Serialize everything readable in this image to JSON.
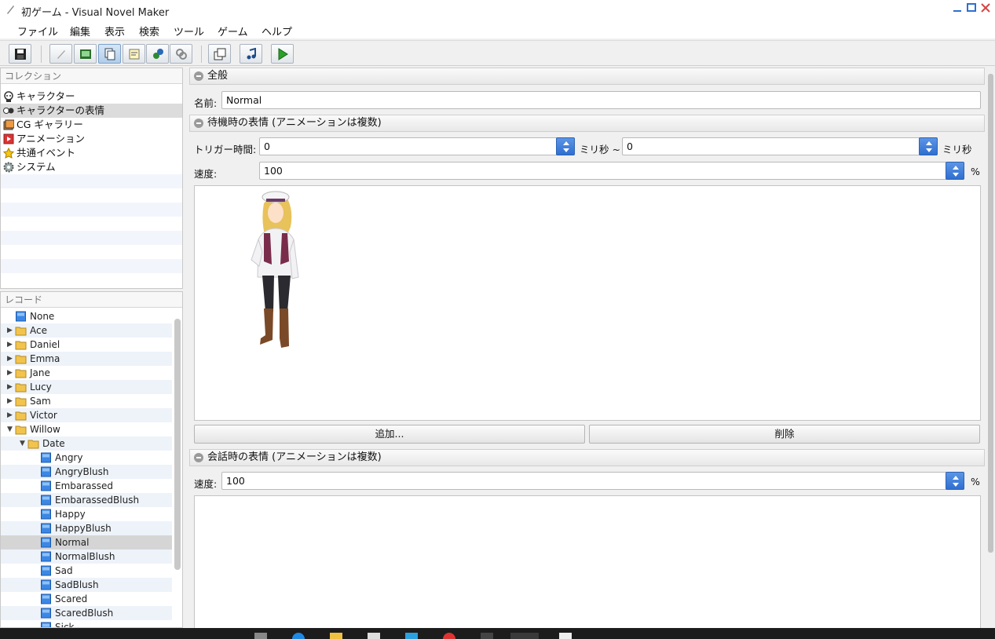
{
  "window": {
    "title": "初ゲーム - Visual Novel Maker"
  },
  "menu": [
    "ファイル",
    "編集",
    "表示",
    "検索",
    "ツール",
    "ゲーム",
    "ヘルプ"
  ],
  "toolbar": {
    "buttons": [
      "save-icon",
      "pencil-icon",
      "picture-icon",
      "database-icon",
      "script-icon",
      "plugin-icon",
      "chain-icon",
      "layers-icon",
      "music-icon",
      "play-icon"
    ],
    "active": "database-icon"
  },
  "collection": {
    "header": "コレクション",
    "items": [
      {
        "label": "キャラクター",
        "icon": "character-icon"
      },
      {
        "label": "キャラクターの表情",
        "icon": "expression-icon",
        "selected": true
      },
      {
        "label": "CG ギャラリー",
        "icon": "gallery-icon"
      },
      {
        "label": "アニメーション",
        "icon": "animation-icon"
      },
      {
        "label": "共通イベント",
        "icon": "star-icon"
      },
      {
        "label": "システム",
        "icon": "gear-icon"
      }
    ]
  },
  "records": {
    "header": "レコード",
    "items": [
      {
        "label": "None",
        "type": "record",
        "depth": 0
      },
      {
        "label": "Ace",
        "type": "folder",
        "depth": 0,
        "state": "collapsed"
      },
      {
        "label": "Daniel",
        "type": "folder",
        "depth": 0,
        "state": "collapsed"
      },
      {
        "label": "Emma",
        "type": "folder",
        "depth": 0,
        "state": "collapsed"
      },
      {
        "label": "Jane",
        "type": "folder",
        "depth": 0,
        "state": "collapsed"
      },
      {
        "label": "Lucy",
        "type": "folder",
        "depth": 0,
        "state": "collapsed"
      },
      {
        "label": "Sam",
        "type": "folder",
        "depth": 0,
        "state": "collapsed"
      },
      {
        "label": "Victor",
        "type": "folder",
        "depth": 0,
        "state": "collapsed"
      },
      {
        "label": "Willow",
        "type": "folder",
        "depth": 0,
        "state": "expanded"
      },
      {
        "label": "Date",
        "type": "folder",
        "depth": 1,
        "state": "expanded"
      },
      {
        "label": "Angry",
        "type": "record",
        "depth": 2
      },
      {
        "label": "AngryBlush",
        "type": "record",
        "depth": 2
      },
      {
        "label": "Embarassed",
        "type": "record",
        "depth": 2
      },
      {
        "label": "EmbarassedBlush",
        "type": "record",
        "depth": 2
      },
      {
        "label": "Happy",
        "type": "record",
        "depth": 2
      },
      {
        "label": "HappyBlush",
        "type": "record",
        "depth": 2
      },
      {
        "label": "Normal",
        "type": "record",
        "depth": 2,
        "selected": true
      },
      {
        "label": "NormalBlush",
        "type": "record",
        "depth": 2
      },
      {
        "label": "Sad",
        "type": "record",
        "depth": 2
      },
      {
        "label": "SadBlush",
        "type": "record",
        "depth": 2
      },
      {
        "label": "Scared",
        "type": "record",
        "depth": 2
      },
      {
        "label": "ScaredBlush",
        "type": "record",
        "depth": 2
      },
      {
        "label": "Sick",
        "type": "record",
        "depth": 2
      }
    ]
  },
  "general": {
    "header": "全般",
    "name_label": "名前:",
    "name_value": "Normal"
  },
  "idle": {
    "header": "待機時の表情 (アニメーションは複数)",
    "trigger_label": "トリガー時間:",
    "trigger_min": "0",
    "unit_ms_range": "ミリ秒 ~",
    "trigger_max": "0",
    "unit_ms": "ミリ秒",
    "speed_label": "速度:",
    "speed_value": "100",
    "percent": "%",
    "add_button": "追加...",
    "delete_button": "削除"
  },
  "talking": {
    "header": "会話時の表情 (アニメーションは複数)",
    "speed_label": "速度:",
    "speed_value": "100",
    "percent": "%"
  },
  "colors": {
    "accent": "#2f6fd0",
    "selection": "#dcdcdc",
    "alt_row": "#eef3fa"
  }
}
